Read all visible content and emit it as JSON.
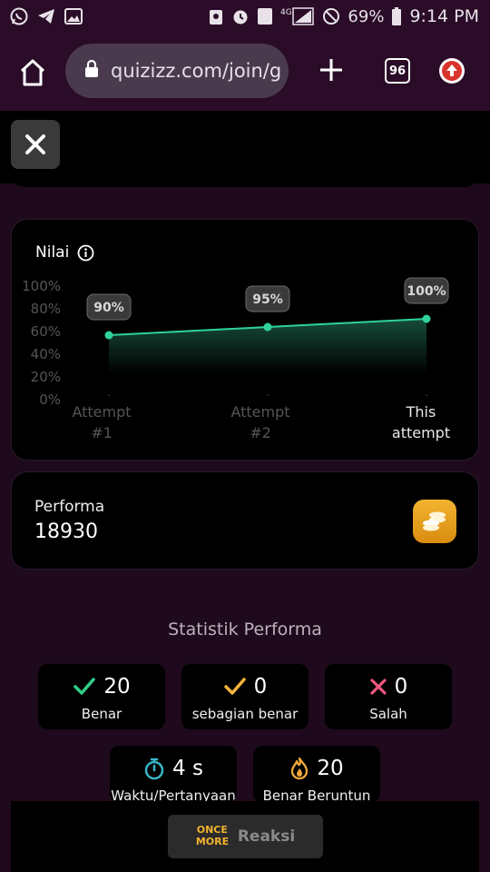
{
  "status_bar": {
    "battery": "69%",
    "time": "9:14 PM",
    "network": "4G",
    "notification_count": "1"
  },
  "browser": {
    "url": "quizizz.com/join/g",
    "tab_count": "96"
  },
  "chart_card": {
    "label": "Nilai"
  },
  "chart_data": {
    "type": "area",
    "categories": [
      "Attempt #1",
      "Attempt #2",
      "This attempt"
    ],
    "x_tick_lines": [
      [
        "Attempt",
        "#1"
      ],
      [
        "Attempt",
        "#2"
      ],
      [
        "This",
        "attempt"
      ]
    ],
    "values": [
      90,
      95,
      100
    ],
    "data_labels": [
      "90%",
      "95%",
      "100%"
    ],
    "y_ticks": [
      "100%",
      "80%",
      "60%",
      "40%",
      "20%",
      "0%"
    ],
    "ylim": [
      0,
      100
    ],
    "title": "Nilai",
    "colors": {
      "line": "#2fd39a",
      "fill_top": "#1a5a45",
      "fill_bottom": "#000000"
    }
  },
  "performa": {
    "label": "Performa",
    "value": "18930"
  },
  "stats_section": {
    "title": "Statistik Performa",
    "items": [
      {
        "value": "20",
        "label": "Benar",
        "icon": "check-icon",
        "color": "#2fcf8a"
      },
      {
        "value": "0",
        "label": "sebagian benar",
        "icon": "check-icon",
        "color": "#f2b43a"
      },
      {
        "value": "0",
        "label": "Salah",
        "icon": "cross-icon",
        "color": "#f0577e"
      },
      {
        "value": "4 s",
        "label": "Waktu/Pertanyaan",
        "icon": "stopwatch-icon",
        "color": "#38b6c9"
      },
      {
        "value": "20",
        "label": "Benar Beruntun",
        "icon": "flame-icon",
        "color": "#f2a93a"
      }
    ]
  },
  "bottom": {
    "reaksi_label": "Reaksi",
    "logo_text": "ONCE MORE"
  }
}
